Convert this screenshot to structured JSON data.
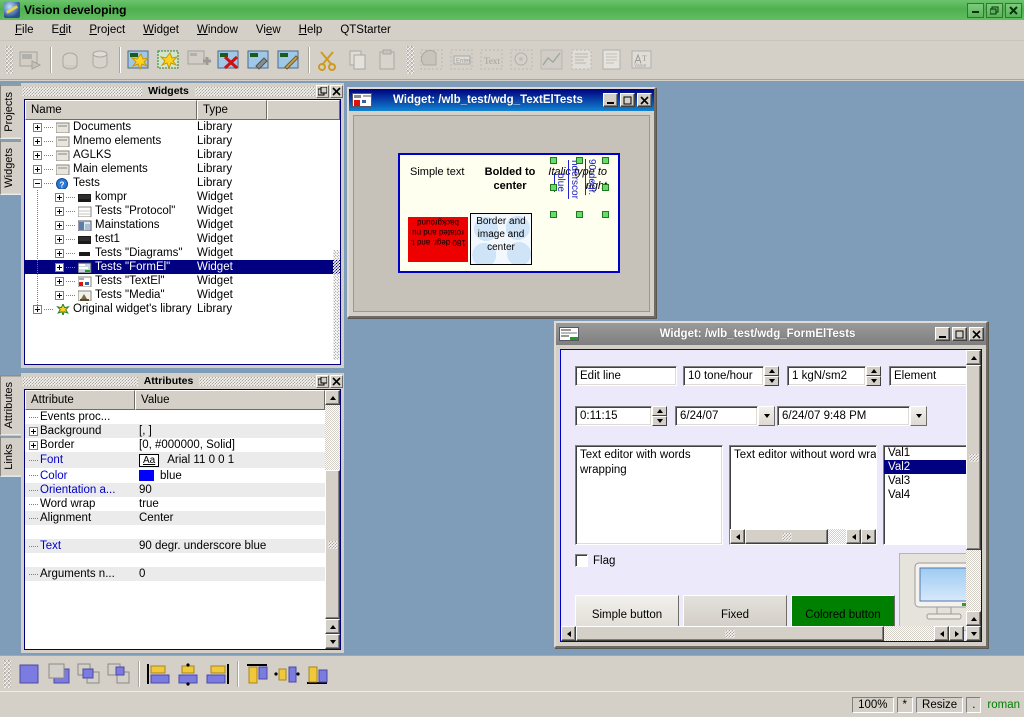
{
  "app": {
    "title": "Vision developing",
    "icon": "vision-app-icon",
    "window_buttons": [
      "minimize",
      "restore",
      "close"
    ]
  },
  "menu": [
    {
      "label": "File",
      "mnemonic": "F"
    },
    {
      "label": "Edit",
      "mnemonic": "E"
    },
    {
      "label": "Project",
      "mnemonic": "P"
    },
    {
      "label": "Widget",
      "mnemonic": "W"
    },
    {
      "label": "Window",
      "mnemonic": "W"
    },
    {
      "label": "View",
      "mnemonic": "V"
    },
    {
      "label": "Help",
      "mnemonic": "H"
    },
    {
      "label": "QTStarter",
      "mnemonic": ""
    }
  ],
  "toolbar": {
    "groups": [
      {
        "items": [
          {
            "name": "project-run-icon",
            "enabled": false
          }
        ]
      },
      {
        "items": [
          {
            "name": "load-from-db-icon",
            "enabled": false
          },
          {
            "name": "save-to-db-icon",
            "enabled": false
          }
        ]
      },
      {
        "items": [
          {
            "name": "new-widget-icon",
            "enabled": true
          },
          {
            "name": "new-library-icon",
            "enabled": true
          },
          {
            "name": "add-widget-icon",
            "enabled": false
          },
          {
            "name": "delete-widget-icon",
            "enabled": true
          },
          {
            "name": "edit-widget-icon",
            "enabled": true
          },
          {
            "name": "properties-widget-icon",
            "enabled": true
          }
        ]
      },
      {
        "items": [
          {
            "name": "cut-icon",
            "enabled": true
          },
          {
            "name": "copy-icon",
            "enabled": false
          },
          {
            "name": "paste-icon",
            "enabled": false
          }
        ]
      },
      {
        "items": [
          {
            "name": "shape-elfig-icon",
            "enabled": false
          },
          {
            "name": "shape-formel-icon",
            "enabled": false
          },
          {
            "name": "shape-text-icon",
            "enabled": false
          },
          {
            "name": "shape-media-icon",
            "enabled": false
          },
          {
            "name": "shape-diagram-icon",
            "enabled": false
          },
          {
            "name": "shape-protocol-icon",
            "enabled": false
          },
          {
            "name": "shape-document-icon",
            "enabled": false
          },
          {
            "name": "shape-value-icon",
            "enabled": false
          }
        ]
      }
    ]
  },
  "left_tabs_top": [
    "Projects",
    "Widgets"
  ],
  "left_tabs_bottom": [
    "Attributes",
    "Links"
  ],
  "widgets_panel": {
    "title": "Widgets",
    "columns": [
      "Name",
      "Type"
    ],
    "rows": [
      {
        "label": "Documents",
        "type": "Library",
        "depth": 0,
        "expander": "plus",
        "icon": "library-documents-icon",
        "selected": false
      },
      {
        "label": "Mnemo elements",
        "type": "Library",
        "depth": 0,
        "expander": "plus",
        "icon": "library-mnemo-icon",
        "selected": false
      },
      {
        "label": "AGLKS",
        "type": "Library",
        "depth": 0,
        "expander": "plus",
        "icon": "library-aglks-icon",
        "selected": false
      },
      {
        "label": "Main elements",
        "type": "Library",
        "depth": 0,
        "expander": "plus",
        "icon": "library-main-icon",
        "selected": false
      },
      {
        "label": "Tests",
        "type": "Library",
        "depth": 0,
        "expander": "minus",
        "icon": "library-tests-question-icon",
        "selected": false
      },
      {
        "label": "kompr",
        "type": "Widget",
        "depth": 1,
        "expander": "plus",
        "icon": "widget-kompr-icon",
        "selected": false
      },
      {
        "label": "Tests \"Protocol\"",
        "type": "Widget",
        "depth": 1,
        "expander": "plus",
        "icon": "widget-protocol-icon",
        "selected": false
      },
      {
        "label": "Mainstations",
        "type": "Widget",
        "depth": 1,
        "expander": "plus",
        "icon": "widget-mainstations-icon",
        "selected": false
      },
      {
        "label": "test1",
        "type": "Widget",
        "depth": 1,
        "expander": "plus",
        "icon": "widget-test1-icon",
        "selected": false
      },
      {
        "label": "Tests \"Diagrams\"",
        "type": "Widget",
        "depth": 1,
        "expander": "plus",
        "icon": "widget-diagrams-icon",
        "selected": false
      },
      {
        "label": "Tests \"FormEl\"",
        "type": "Widget",
        "depth": 1,
        "expander": "plus",
        "icon": "widget-formel-icon",
        "selected": true
      },
      {
        "label": "Tests \"TextEl\"",
        "type": "Widget",
        "depth": 1,
        "expander": "plus",
        "icon": "widget-textel-icon",
        "selected": false
      },
      {
        "label": "Tests \"Media\"",
        "type": "Widget",
        "depth": 1,
        "expander": "plus",
        "icon": "widget-media-icon",
        "selected": false
      },
      {
        "label": "Original widget's library",
        "type": "Library",
        "depth": 0,
        "expander": "plus",
        "icon": "library-original-icon",
        "selected": false
      }
    ]
  },
  "attributes_panel": {
    "title": "Attributes",
    "columns": [
      "Attribute",
      "Value"
    ],
    "rows": [
      {
        "name": "Events proc...",
        "value": "",
        "expander": "none",
        "blue": false,
        "kind": "text"
      },
      {
        "name": "Background",
        "value": "[, ]",
        "expander": "plus",
        "blue": false,
        "kind": "text"
      },
      {
        "name": "Border",
        "value": "[0, #000000, Solid]",
        "expander": "plus",
        "blue": false,
        "kind": "text"
      },
      {
        "name": "Font",
        "value": "Arial 11 0 0 1",
        "expander": "none",
        "blue": true,
        "kind": "font",
        "font_button": "Aa"
      },
      {
        "name": "Color",
        "value": "blue",
        "expander": "none",
        "blue": true,
        "kind": "color",
        "swatch": "#0000ff"
      },
      {
        "name": "Orientation a...",
        "value": "90",
        "expander": "none",
        "blue": true,
        "kind": "text"
      },
      {
        "name": "Word wrap",
        "value": "true",
        "expander": "none",
        "blue": false,
        "kind": "text"
      },
      {
        "name": "Alignment",
        "value": "Center",
        "expander": "none",
        "blue": false,
        "kind": "text"
      },
      {
        "name": "",
        "value": "",
        "expander": "none",
        "blue": false,
        "kind": "text"
      },
      {
        "name": "Text",
        "value": "90 degr. underscore blue",
        "expander": "none",
        "blue": true,
        "kind": "text"
      },
      {
        "name": "",
        "value": "",
        "expander": "none",
        "blue": false,
        "kind": "text"
      },
      {
        "name": "Arguments n...",
        "value": "0",
        "expander": "none",
        "blue": false,
        "kind": "text"
      }
    ]
  },
  "textel_window": {
    "title": "Widget: /wlb_test/wdg_TextElTests",
    "icon": "widget-textel-icon",
    "buttons": [
      "minimize",
      "maximize",
      "close"
    ],
    "canvas": {
      "elements": [
        {
          "name": "simple-text",
          "text": "Simple text",
          "style": "normal"
        },
        {
          "name": "bolded-center-text",
          "text": "Bolded to center",
          "style": "bold"
        },
        {
          "name": "italic-right-text",
          "text": "Italic type to right",
          "style": "italic"
        },
        {
          "name": "blue-underline-text",
          "text": "blue",
          "style": "rotated-underline-blue"
        },
        {
          "name": "underscore-text",
          "text": "nderscor",
          "style": "rotated-underline-blue"
        },
        {
          "name": "ninety-degree-text",
          "text": "90 degr.",
          "style": "rotated-underline-blue",
          "selected": true
        },
        {
          "name": "red-background-text",
          "text": "180 degr. and t. rotated and nu background",
          "style": "rotated-180-red"
        },
        {
          "name": "border-image-text",
          "text": "Border and image and center",
          "style": "image-background"
        }
      ]
    }
  },
  "formel_window": {
    "title": "Widget: /wlb_test/wdg_FormElTests",
    "icon": "widget-formel-icon",
    "buttons": [
      {
        "name": "simple-button",
        "label": "Simple button",
        "color": ""
      },
      {
        "name": "fixed-button",
        "label": "Fixed",
        "color": ""
      },
      {
        "name": "colored-button",
        "label": "Colored button",
        "color": "#008000"
      }
    ],
    "row1": [
      {
        "name": "edit-line-input",
        "value": "Edit line",
        "kind": "lineedit"
      },
      {
        "name": "tone-hour-spinbox",
        "value": "10 tone/hour",
        "kind": "spinbox"
      },
      {
        "name": "kgn-sm2-spinbox",
        "value": "1 kgN/sm2",
        "kind": "spinbox"
      },
      {
        "name": "element-combobox",
        "value": "Element",
        "kind": "combobox"
      }
    ],
    "row2": [
      {
        "name": "time-spinbox",
        "value": "0:11:15",
        "kind": "spinbox"
      },
      {
        "name": "date-combobox",
        "value": "6/24/07",
        "kind": "combobox"
      },
      {
        "name": "datetime-combobox",
        "value": "6/24/07 9:48 PM",
        "kind": "combobox"
      }
    ],
    "editors": [
      {
        "name": "text-editor-wrapping",
        "value": "Text editor with words wrapping",
        "wrap": true
      },
      {
        "name": "text-editor-nowrap",
        "value": "Text editor without word wrap",
        "wrap": false
      }
    ],
    "list": {
      "name": "value-list",
      "items": [
        "Val1",
        "Val2",
        "Val3",
        "Val4"
      ],
      "selected": "Val2"
    },
    "checkbox": {
      "name": "flag-checkbox",
      "label": "Flag",
      "checked": false
    },
    "image": {
      "name": "monitor-image",
      "label": "monitor"
    }
  },
  "bottom_toolbar": {
    "items": [
      {
        "name": "raise-to-front-icon"
      },
      {
        "name": "lower-to-back-icon"
      },
      {
        "name": "raise-one-icon"
      },
      {
        "name": "lower-one-icon"
      },
      {
        "name": "align-left-icon"
      },
      {
        "name": "align-vcenter-icon"
      },
      {
        "name": "align-right-icon"
      },
      {
        "name": "align-top-icon"
      },
      {
        "name": "align-hcenter-icon"
      },
      {
        "name": "align-bottom-icon"
      }
    ]
  },
  "statusbar": {
    "zoom": "100%",
    "modified": "*",
    "mode": "Resize",
    "dot": ".",
    "user": "roman"
  }
}
